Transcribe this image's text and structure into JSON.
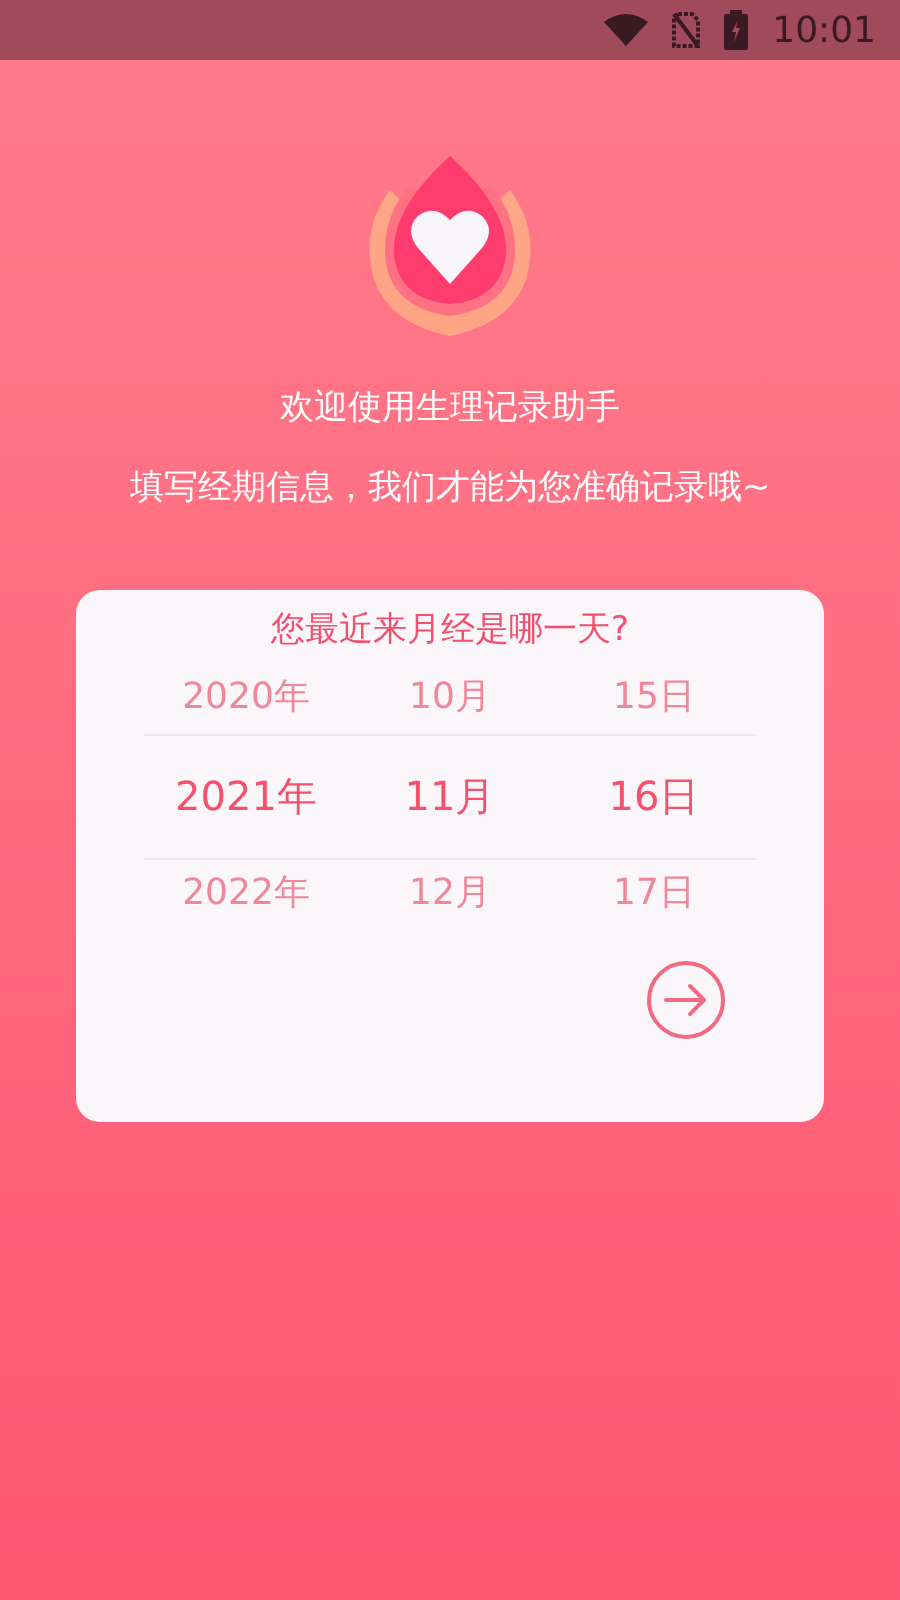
{
  "status_bar": {
    "time": "10:01"
  },
  "welcome": {
    "title": "欢迎使用生理记录助手",
    "subtitle": "填写经期信息，我们才能为您准确记录哦~"
  },
  "picker": {
    "question": "您最近来月经是哪一天?",
    "columns": [
      {
        "items": [
          {
            "label": "2020年",
            "selected": false
          },
          {
            "label": "2021年",
            "selected": true
          },
          {
            "label": "2022年",
            "selected": false
          }
        ]
      },
      {
        "items": [
          {
            "label": "10月",
            "selected": false
          },
          {
            "label": "11月",
            "selected": true
          },
          {
            "label": "12月",
            "selected": false
          }
        ]
      },
      {
        "items": [
          {
            "label": "15日",
            "selected": false
          },
          {
            "label": "16日",
            "selected": true
          },
          {
            "label": "17日",
            "selected": false
          }
        ]
      }
    ]
  }
}
